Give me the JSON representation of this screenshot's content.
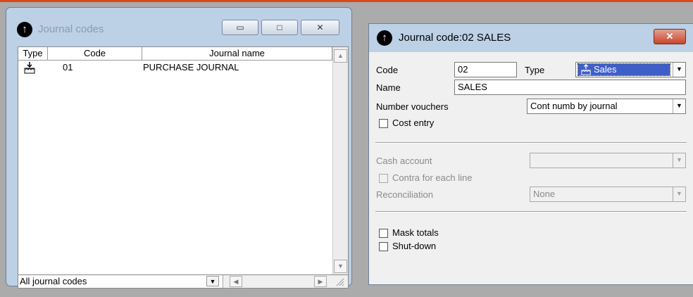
{
  "list_window": {
    "title": "Journal codes",
    "columns": [
      "Type",
      "Code",
      "Journal name"
    ],
    "rows": [
      {
        "type_icon": "purchase-journal-icon",
        "code": "01",
        "name": "PURCHASE JOURNAL"
      }
    ],
    "filter_value": "All journal codes"
  },
  "detail_window": {
    "title": "Journal code:02 SALES",
    "code_label": "Code",
    "code_value": "02",
    "type_label": "Type",
    "type_value": "Sales",
    "name_label": "Name",
    "name_value": "SALES",
    "number_vouchers_label": "Number vouchers",
    "number_vouchers_value": "Cont numb by journal",
    "cost_entry_label": "Cost entry",
    "cash_account_label": "Cash account",
    "cash_account_value": "",
    "contra_label": "Contra for each line",
    "reconciliation_label": "Reconciliation",
    "reconciliation_value": "None",
    "mask_totals_label": "Mask totals",
    "shutdown_label": "Shut-down"
  },
  "colors": {
    "selection": "#3f5fc8",
    "close_button": "#c8452c",
    "title_bar": "#bcd0e6"
  }
}
